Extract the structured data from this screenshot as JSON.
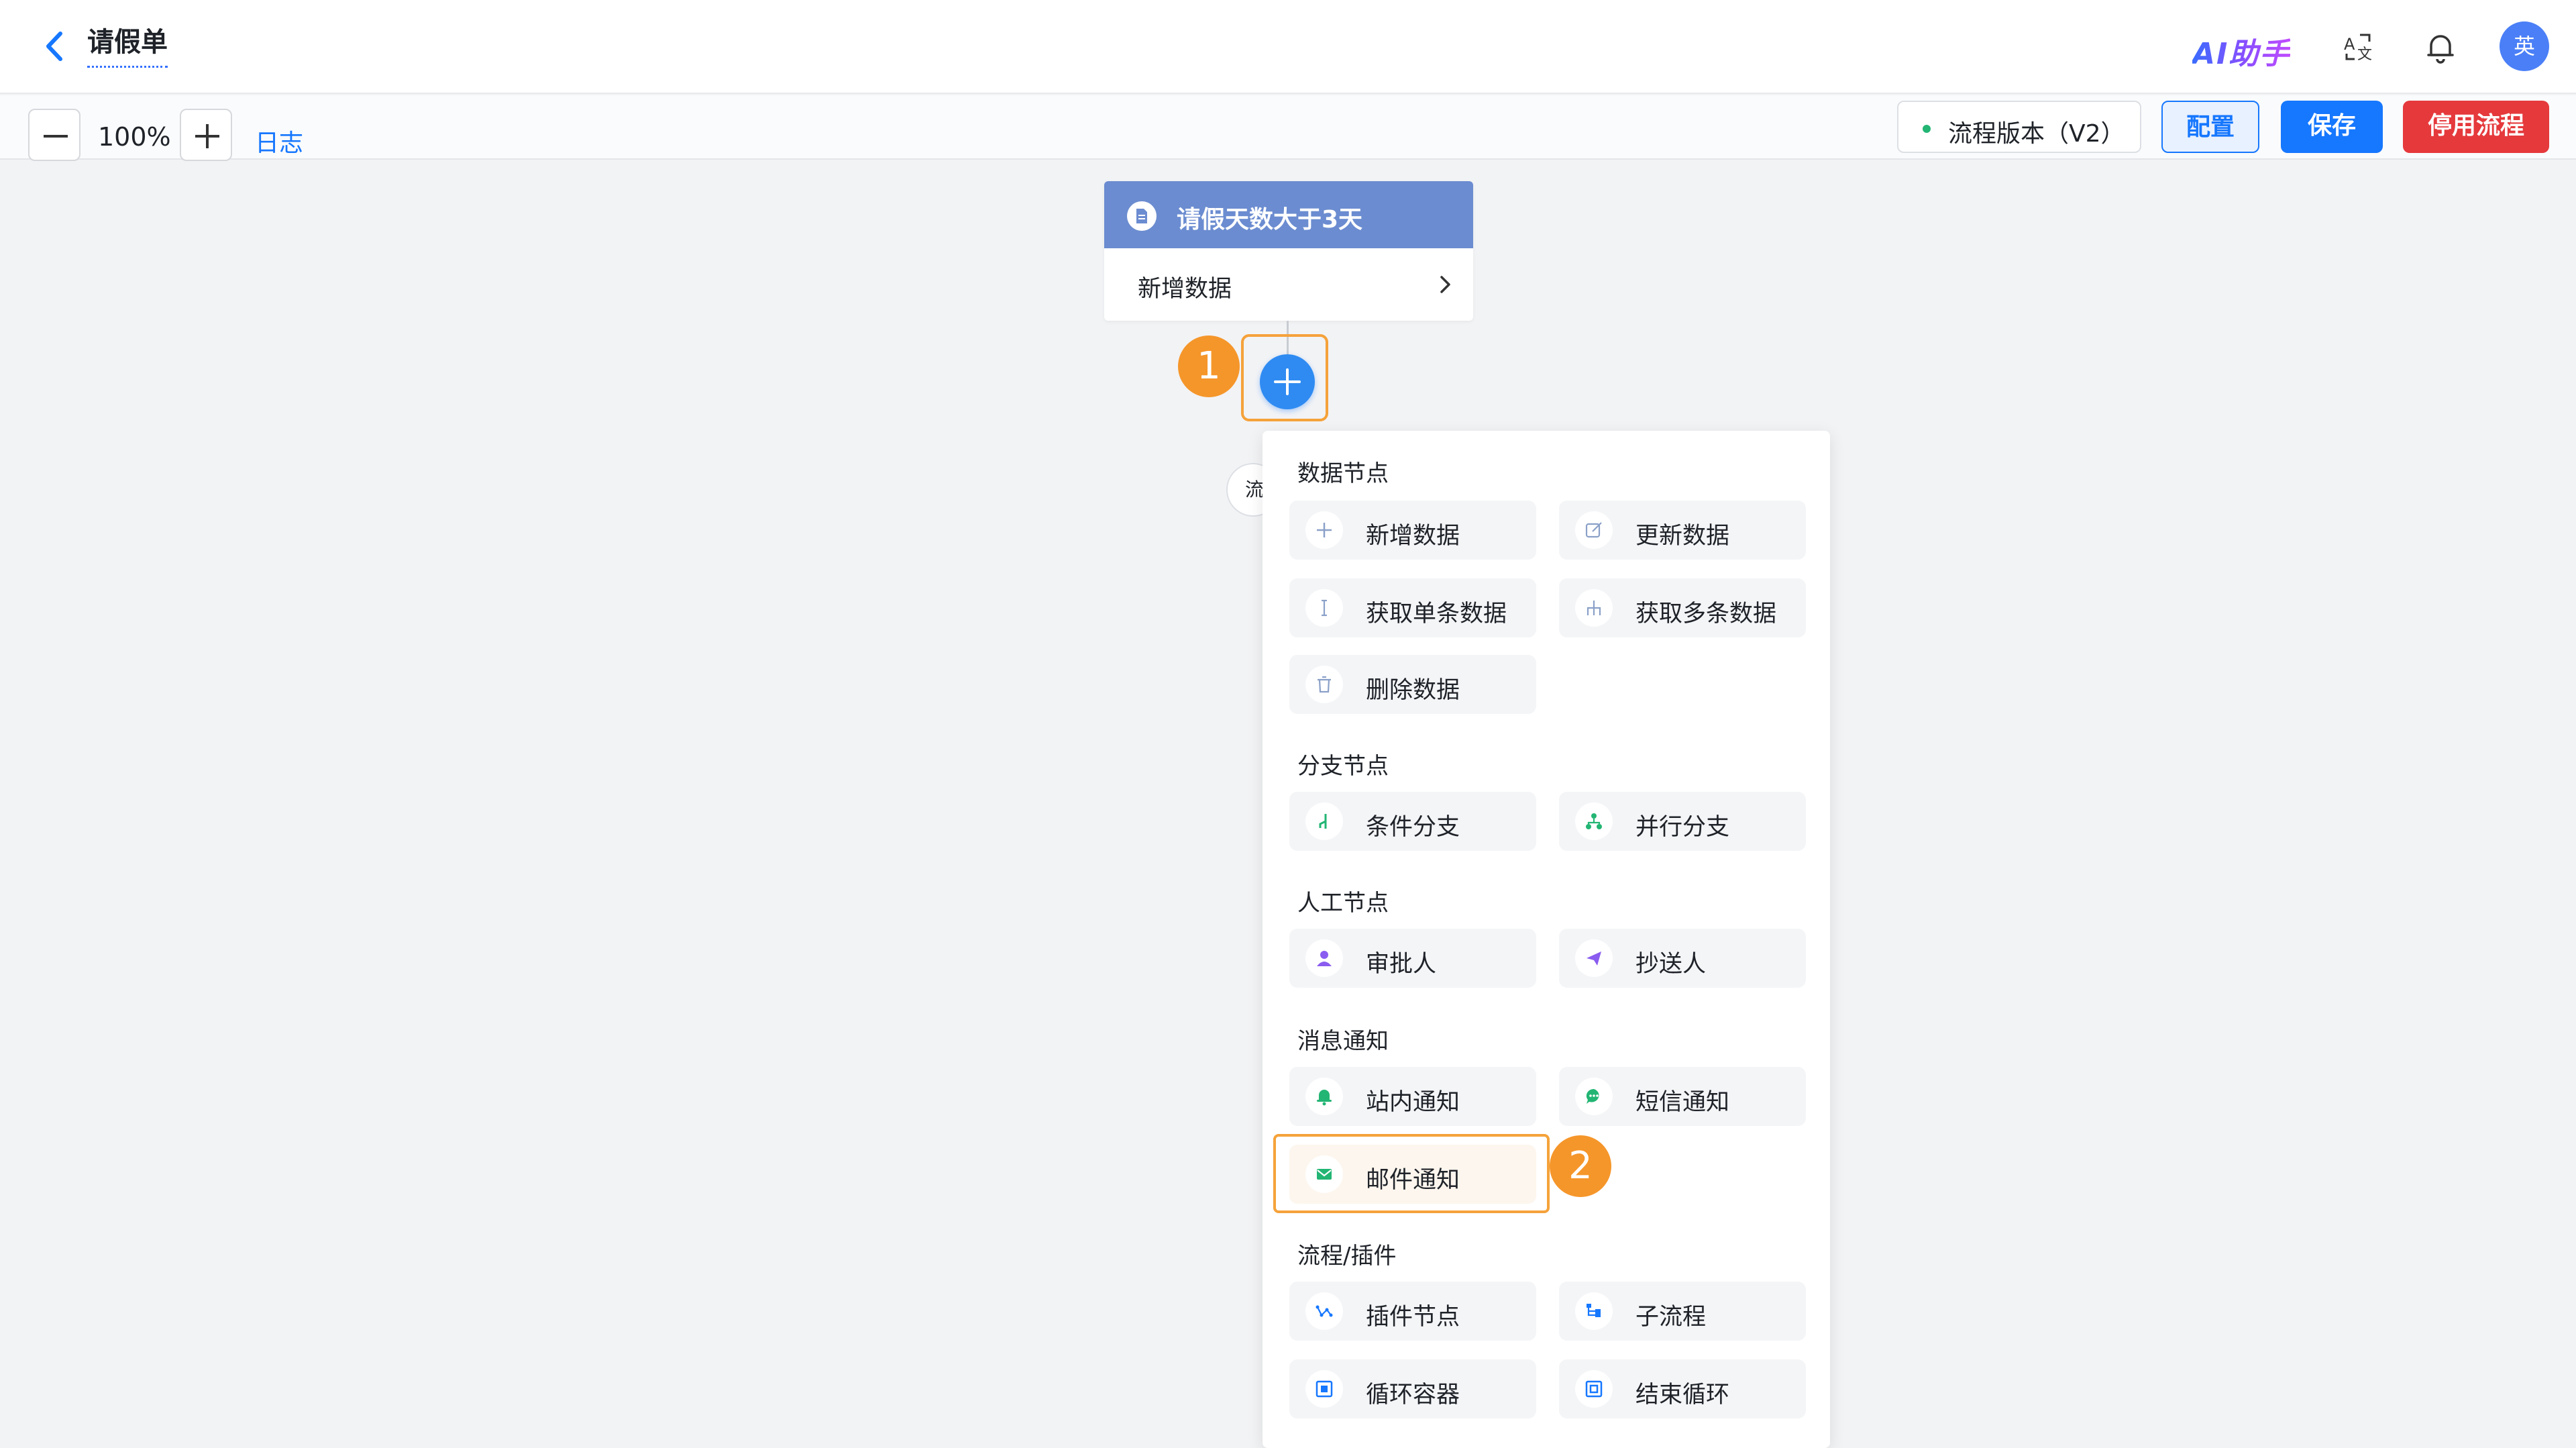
{
  "header": {
    "title": "请假单",
    "ai_assistant": "AI助手",
    "avatar_text": "英"
  },
  "toolbar": {
    "zoom_value": "100%",
    "log_label": "日志",
    "version_label": "流程版本（V2）",
    "config_label": "配置",
    "save_label": "保存",
    "stop_label": "停用流程"
  },
  "trigger": {
    "title": "请假天数大于3天",
    "action": "新增数据"
  },
  "annotations": {
    "step1": "1",
    "step2": "2"
  },
  "canvas": {
    "stub_char": "流"
  },
  "menu": {
    "sections": [
      {
        "title": "数据节点",
        "items": [
          {
            "label": "新增数据",
            "icon": "plus-icon"
          },
          {
            "label": "更新数据",
            "icon": "edit-icon"
          },
          {
            "label": "获取单条数据",
            "icon": "single-data-icon"
          },
          {
            "label": "获取多条数据",
            "icon": "multi-data-icon"
          },
          {
            "label": "删除数据",
            "icon": "trash-icon"
          }
        ]
      },
      {
        "title": "分支节点",
        "items": [
          {
            "label": "条件分支",
            "icon": "condition-branch-icon"
          },
          {
            "label": "并行分支",
            "icon": "parallel-branch-icon"
          }
        ]
      },
      {
        "title": "人工节点",
        "items": [
          {
            "label": "审批人",
            "icon": "user-icon"
          },
          {
            "label": "抄送人",
            "icon": "send-icon"
          }
        ]
      },
      {
        "title": "消息通知",
        "items": [
          {
            "label": "站内通知",
            "icon": "bell-icon"
          },
          {
            "label": "短信通知",
            "icon": "sms-icon"
          },
          {
            "label": "邮件通知",
            "icon": "mail-icon"
          }
        ]
      },
      {
        "title": "流程/插件",
        "items": [
          {
            "label": "插件节点",
            "icon": "plugin-icon"
          },
          {
            "label": "子流程",
            "icon": "subflow-icon"
          },
          {
            "label": "循环容器",
            "icon": "loop-container-icon"
          },
          {
            "label": "结束循环",
            "icon": "end-loop-icon"
          }
        ]
      }
    ]
  },
  "colors": {
    "primary": "#1677ff",
    "danger": "#e5393c",
    "highlight": "#f5a23a",
    "trigger_header": "#6b8cd0",
    "green": "#22b573",
    "purple": "#8a5cf0"
  }
}
